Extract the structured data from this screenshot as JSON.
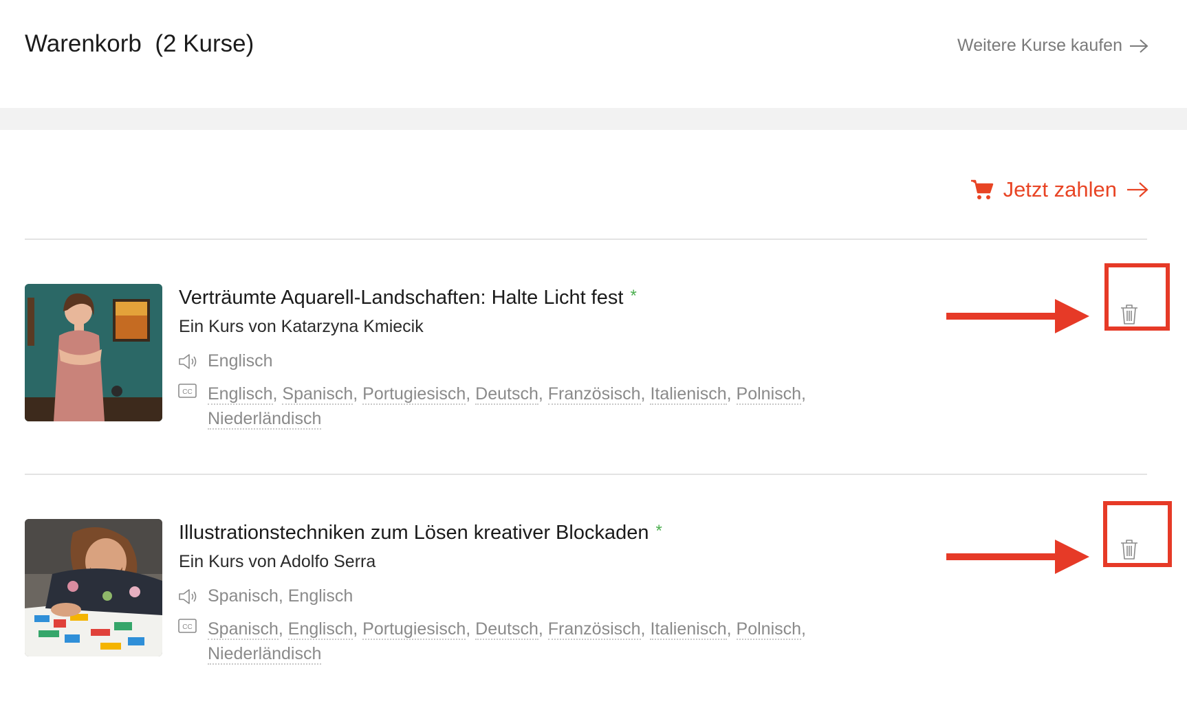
{
  "header": {
    "title": "Warenkorb  (2 Kurse)",
    "more_link": "Weitere Kurse kaufen"
  },
  "pay_button": {
    "label": "Jetzt zahlen"
  },
  "colors": {
    "accent": "#e84424",
    "star": "#4caf50",
    "annotation": "#e63a27"
  },
  "icons": [
    "arrow-right-icon",
    "cart-icon",
    "speaker-icon",
    "cc-icon",
    "trash-icon"
  ],
  "courses": [
    {
      "title": "Verträumte Aquarell-Landschaften: Halte Licht fest",
      "star": "*",
      "author": "Ein Kurs von Katarzyna Kmiecik",
      "audio": "Englisch",
      "subtitles": [
        "Englisch",
        "Spanisch",
        "Portugiesisch",
        "Deutsch",
        "Französisch",
        "Italienisch",
        "Polnisch",
        "Niederländisch"
      ]
    },
    {
      "title": "Illustrationstechniken zum Lösen kreativer Blockaden",
      "star": "*",
      "author": "Ein Kurs von Adolfo Serra",
      "audio": "Spanisch, Englisch",
      "subtitles": [
        "Spanisch",
        "Englisch",
        "Portugiesisch",
        "Deutsch",
        "Französisch",
        "Italienisch",
        "Polnisch",
        "Niederländisch"
      ]
    }
  ]
}
